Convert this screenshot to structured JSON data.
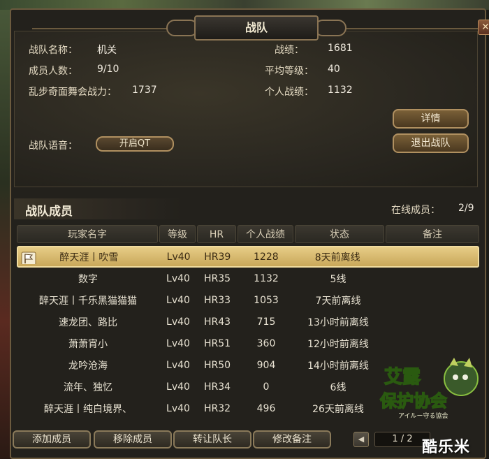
{
  "window": {
    "title": "战队",
    "close_label": "✕"
  },
  "info": {
    "name_label": "战队名称：",
    "name_value": "机关",
    "members_label": "成员人数：",
    "members_value": "9/10",
    "power_label": "乱步奇面舞会战力：",
    "power_value": "1737",
    "score_label": "战绩：",
    "score_value": "1681",
    "avg_level_label": "平均等级：",
    "avg_level_value": "40",
    "personal_score_label": "个人战绩：",
    "personal_score_value": "1132",
    "voice_label": "战队语音：",
    "voice_button": "开启QT",
    "details_button": "详情",
    "leave_button": "退出战队"
  },
  "members": {
    "title": "战队成员",
    "online_label": "在线成员：",
    "online_value": "2/9",
    "columns": [
      "玩家名字",
      "等级",
      "HR",
      "个人战绩",
      "状态",
      "备注"
    ],
    "rows": [
      {
        "name": "醉天涯丨吹雪",
        "level": "Lv40",
        "hr": "HR39",
        "score": "1228",
        "status": "8天前离线",
        "note": "",
        "selected": true
      },
      {
        "name": "数字",
        "level": "Lv40",
        "hr": "HR35",
        "score": "1132",
        "status": "5线",
        "note": ""
      },
      {
        "name": "醉天涯丨千乐黑猫猫猫",
        "level": "Lv40",
        "hr": "HR33",
        "score": "1053",
        "status": "7天前离线",
        "note": ""
      },
      {
        "name": "速龙团、路比",
        "level": "Lv40",
        "hr": "HR43",
        "score": "715",
        "status": "13小时前离线",
        "note": ""
      },
      {
        "name": "萧萧宵小",
        "level": "Lv40",
        "hr": "HR51",
        "score": "360",
        "status": "12小时前离线",
        "note": ""
      },
      {
        "name": "龙吟沧海",
        "level": "Lv40",
        "hr": "HR50",
        "score": "904",
        "status": "14小时前离线",
        "note": ""
      },
      {
        "name": "流年、独忆",
        "level": "Lv40",
        "hr": "HR34",
        "score": "0",
        "status": "6线",
        "note": ""
      },
      {
        "name": "醉天涯丨纯白境界、",
        "level": "Lv40",
        "hr": "HR32",
        "score": "496",
        "status": "26天前离线",
        "note": ""
      }
    ]
  },
  "bottom": {
    "add_button": "添加成员",
    "remove_button": "移除成员",
    "transfer_button": "转让队长",
    "edit_note_button": "修改备注",
    "page_indicator": "1 / 2",
    "prev_label": "◀"
  },
  "logo": {
    "line1": "艾露",
    "line2": "保护协会",
    "sub": "アイルー守る協会"
  },
  "watermark": "酷乐米",
  "colors": {
    "accent_gold": "#c9a85a",
    "frame": "#8a7454",
    "panel": "#2a2720"
  },
  "icons": {
    "flag": "flag-icon",
    "close": "close-icon",
    "prev": "chevron-left-icon"
  }
}
